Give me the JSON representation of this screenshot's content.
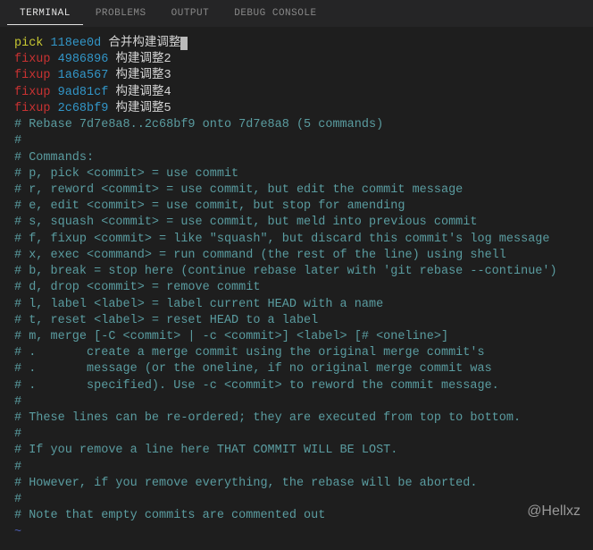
{
  "tabs": {
    "terminal": "TERMINAL",
    "problems": "PROBLEMS",
    "output": "OUTPUT",
    "debug": "DEBUG CONSOLE"
  },
  "rebase_lines": [
    {
      "action": "pick",
      "hash": "118ee0d",
      "msg": "合并构建调整",
      "cursor": true
    },
    {
      "action": "fixup",
      "hash": "4986896",
      "msg": "构建调整2"
    },
    {
      "action": "fixup",
      "hash": "1a6a567",
      "msg": "构建调整3"
    },
    {
      "action": "fixup",
      "hash": "9ad81cf",
      "msg": "构建调整4"
    },
    {
      "action": "fixup",
      "hash": "2c68bf9",
      "msg": "构建调整5"
    }
  ],
  "comments": [
    "",
    "# Rebase 7d7e8a8..2c68bf9 onto 7d7e8a8 (5 commands)",
    "#",
    "# Commands:",
    "# p, pick <commit> = use commit",
    "# r, reword <commit> = use commit, but edit the commit message",
    "# e, edit <commit> = use commit, but stop for amending",
    "# s, squash <commit> = use commit, but meld into previous commit",
    "# f, fixup <commit> = like \"squash\", but discard this commit's log message",
    "# x, exec <command> = run command (the rest of the line) using shell",
    "# b, break = stop here (continue rebase later with 'git rebase --continue')",
    "# d, drop <commit> = remove commit",
    "# l, label <label> = label current HEAD with a name",
    "# t, reset <label> = reset HEAD to a label",
    "# m, merge [-C <commit> | -c <commit>] <label> [# <oneline>]",
    "# .       create a merge commit using the original merge commit's",
    "# .       message (or the oneline, if no original merge commit was",
    "# .       specified). Use -c <commit> to reword the commit message.",
    "#",
    "# These lines can be re-ordered; they are executed from top to bottom.",
    "#",
    "# If you remove a line here THAT COMMIT WILL BE LOST.",
    "#",
    "# However, if you remove everything, the rebase will be aborted.",
    "#",
    "# Note that empty commits are commented out"
  ],
  "tilde": "~",
  "watermark": "@Hellxz"
}
